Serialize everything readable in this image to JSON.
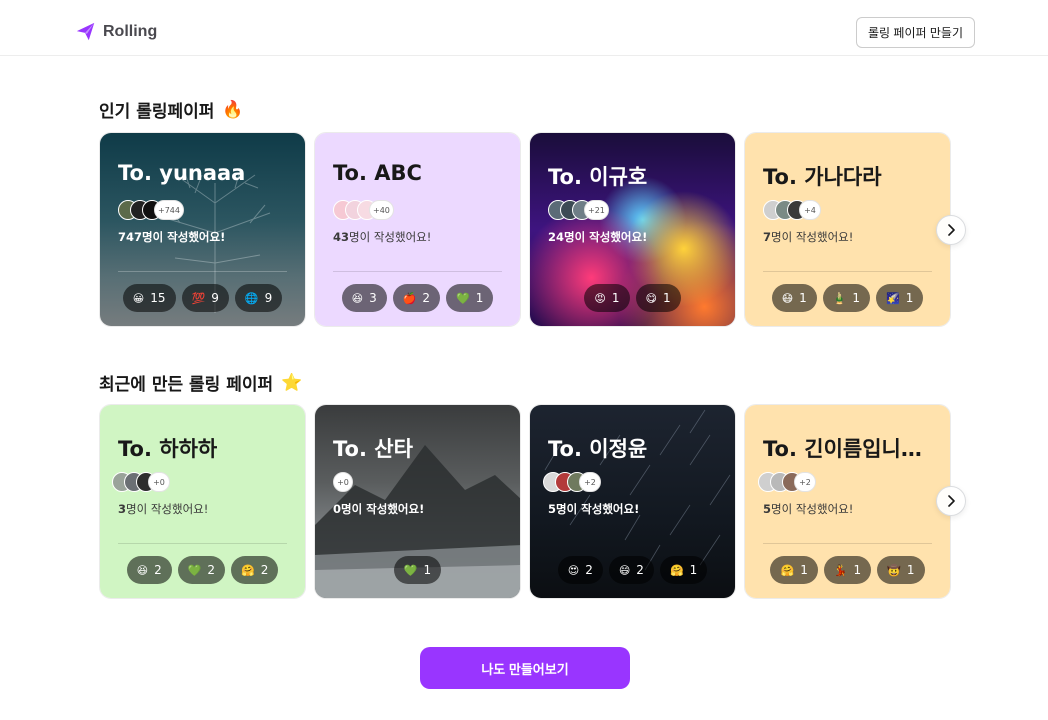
{
  "header": {
    "logo_text": "Rolling",
    "create_button": "롤링 페이퍼 만들기"
  },
  "popular": {
    "title": "인기 롤링페이퍼",
    "emoji": "🔥",
    "cards": [
      {
        "to": "To. yunaaa",
        "more": "+744",
        "count": "747",
        "suffix": "명이 작성했어요!",
        "reactions": [
          {
            "emoji": "😀",
            "count": "15"
          },
          {
            "emoji": "💯",
            "count": "9"
          },
          {
            "emoji": "🌐",
            "count": "9"
          }
        ]
      },
      {
        "to": "To. ABC",
        "more": "+40",
        "count": "43",
        "suffix": "명이 작성했어요!",
        "reactions": [
          {
            "emoji": "😆",
            "count": "3"
          },
          {
            "emoji": "🍎",
            "count": "2"
          },
          {
            "emoji": "💚",
            "count": "1"
          }
        ]
      },
      {
        "to": "To. 이규호",
        "more": "+21",
        "count": "24",
        "suffix": "명이 작성했어요!",
        "reactions": [
          {
            "emoji": "😡",
            "count": "1"
          },
          {
            "emoji": "😋",
            "count": "1"
          }
        ]
      },
      {
        "to": "To. 가나다라",
        "more": "+4",
        "count": "7",
        "suffix": "명이 작성했어요!",
        "reactions": [
          {
            "emoji": "😷",
            "count": "1"
          },
          {
            "emoji": "🎍",
            "count": "1"
          },
          {
            "emoji": "🌠",
            "count": "1"
          }
        ]
      }
    ]
  },
  "recent": {
    "title": "최근에 만든 롤링 페이퍼",
    "emoji": "⭐",
    "cards": [
      {
        "to": "To. 하하하",
        "more": "+0",
        "count": "3",
        "suffix": "명이 작성했어요!",
        "reactions": [
          {
            "emoji": "😆",
            "count": "2"
          },
          {
            "emoji": "💚",
            "count": "2"
          },
          {
            "emoji": "🤗",
            "count": "2"
          }
        ]
      },
      {
        "to": "To. 산타",
        "more": "+0",
        "count": "0",
        "suffix": "명이 작성했어요!",
        "reactions": [
          {
            "emoji": "💚",
            "count": "1"
          }
        ]
      },
      {
        "to": "To. 이정윤",
        "more": "+2",
        "count": "5",
        "suffix": "명이 작성했어요!",
        "reactions": [
          {
            "emoji": "😍",
            "count": "2"
          },
          {
            "emoji": "😄",
            "count": "2"
          },
          {
            "emoji": "🤗",
            "count": "1"
          }
        ]
      },
      {
        "to": "To. 긴이름입니다…",
        "more": "+2",
        "count": "5",
        "suffix": "명이 작성했어요!",
        "reactions": [
          {
            "emoji": "🤗",
            "count": "1"
          },
          {
            "emoji": "💃",
            "count": "1"
          },
          {
            "emoji": "🤠",
            "count": "1"
          }
        ]
      }
    ]
  },
  "cta_label": "나도 만들어보기",
  "colors": {
    "accent": "#9935ff",
    "purple_card": "#ecd9ff",
    "beige_card": "#ffe2ad",
    "green_card": "#d0f5c3"
  },
  "icons": {
    "logo": "paper-plane-icon",
    "arrow": "chevron-right-icon"
  }
}
